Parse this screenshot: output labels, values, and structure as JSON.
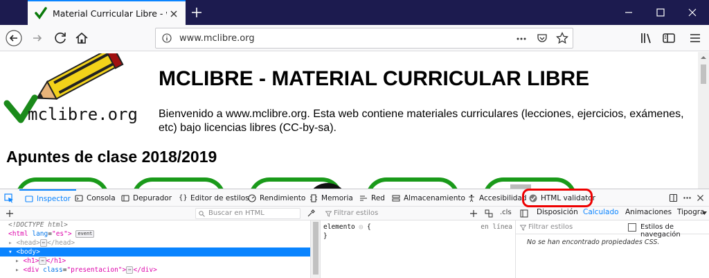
{
  "browser": {
    "tab_title": "Material Curricular Libre - www.mclibre.org",
    "url": "www.mclibre.org"
  },
  "page": {
    "logo_text": "mclibre.org",
    "site_title": "MCLIBRE - MATERIAL CURRICULAR LIBRE",
    "intro": "Bienvenido a www.mclibre.org. Esta web contiene materiales curriculares (lecciones, ejercicios, exámenes, etc) bajo licencias libres (CC-by-sa).",
    "section_title": "Apuntes de clase 2018/2019"
  },
  "devtools": {
    "tabs": [
      {
        "label": "Inspector",
        "icon": "inspector-icon"
      },
      {
        "label": "Consola",
        "icon": "console-icon"
      },
      {
        "label": "Depurador",
        "icon": "debugger-icon"
      },
      {
        "label": "Editor de estilos",
        "icon": "style-editor-icon"
      },
      {
        "label": "Rendimiento",
        "icon": "performance-icon"
      },
      {
        "label": "Memoria",
        "icon": "memory-icon"
      },
      {
        "label": "Red",
        "icon": "network-icon"
      },
      {
        "label": "Almacenamiento",
        "icon": "storage-icon"
      },
      {
        "label": "Accesibilidad",
        "icon": "accessibility-icon"
      },
      {
        "label": "HTML validator",
        "icon": "html-validator-icon"
      }
    ],
    "search_html_placeholder": "Buscar en HTML",
    "filter_styles_placeholder": "Filtrar estilos",
    "cls_label": ".cls",
    "side_tabs": [
      "Disposición",
      "Calculado",
      "Animaciones",
      "Tipogra"
    ],
    "computed_filter_placeholder": "Filtrar estilos",
    "browser_styles_label": "Estilos de navegación",
    "empty_computed": "No se han encontrado propiedades CSS.",
    "rule_element": "elemento",
    "rule_brace_open": "{",
    "rule_brace_close": "}",
    "rule_location": "en línea",
    "markup": {
      "doctype": "<!DOCTYPE html>",
      "html_tag": "<html",
      "html_attr": "lang",
      "html_val": "\"es\"",
      "html_close": ">",
      "event_badge": "event",
      "head": "<head>",
      "head_close": "</head>",
      "ellipsis": "⋯",
      "body": "<body>",
      "h1_open": "<h1>",
      "h1_close": "</h1>",
      "div_open": "<div",
      "div_attr": "class",
      "div_val": "\"presentacion\"",
      "div_gt": ">",
      "div_close": "</div>"
    }
  },
  "colors": {
    "accent": "#0a84ff",
    "titlebar": "#1c1b4f",
    "card_border": "#1a9a1a",
    "highlight": "#ee0000"
  }
}
